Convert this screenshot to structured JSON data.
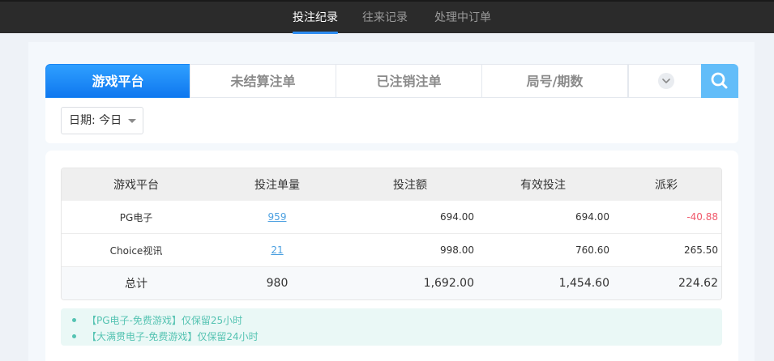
{
  "top_tabs": [
    {
      "label": "投注纪录",
      "active": true
    },
    {
      "label": "往来记录",
      "active": false
    },
    {
      "label": "处理中订单",
      "active": false
    }
  ],
  "platform_tabs": [
    {
      "label": "游戏平台",
      "active": true
    },
    {
      "label": "未结算注单",
      "active": false
    },
    {
      "label": "已注销注单",
      "active": false
    },
    {
      "label": "局号/期数",
      "active": false
    }
  ],
  "filters": {
    "date_label": "日期: 今日"
  },
  "table": {
    "headers": [
      "游戏平台",
      "投注单量",
      "投注额",
      "有效投注",
      "派彩"
    ],
    "rows": [
      {
        "platform": "PG电子",
        "count": "959",
        "bet": "694.00",
        "valid": "694.00",
        "payout": "-40.88"
      },
      {
        "platform": "Choice视讯",
        "count": "21",
        "bet": "998.00",
        "valid": "760.60",
        "payout": "265.50"
      }
    ],
    "total": {
      "label": "总计",
      "count": "980",
      "bet": "1,692.00",
      "valid": "1,454.60",
      "payout": "224.62"
    }
  },
  "notices": [
    "【PG电子-免费游戏】仅保留25小时",
    "【大满贯电子-免费游戏】仅保留24小时"
  ],
  "colors": {
    "accent": "#2d8cf0",
    "tab_active": "#1a86f4",
    "search": "#62bdf9",
    "negative": "#f0596b",
    "notice_text": "#55c3b2"
  },
  "icons": {
    "search": "search-icon",
    "more": "chevron-down-icon",
    "date_caret": "caret-down-icon"
  }
}
